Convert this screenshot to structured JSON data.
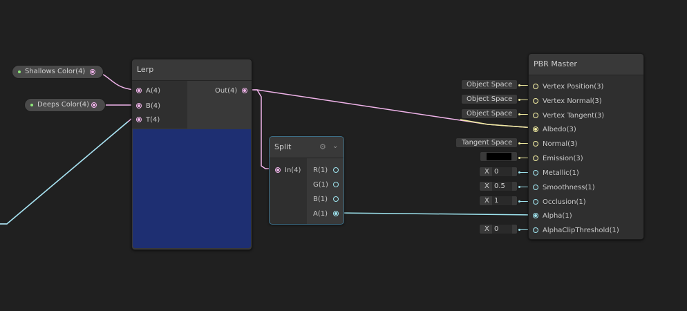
{
  "properties": {
    "shallows": {
      "label": "Shallows Color(4)"
    },
    "deeps": {
      "label": "Deeps Color(4)"
    }
  },
  "lerp": {
    "title": "Lerp",
    "inputs": [
      "A(4)",
      "B(4)",
      "T(4)"
    ],
    "output": "Out(4)",
    "preview_color": "#1e2f72"
  },
  "split": {
    "title": "Split",
    "input": "In(4)",
    "outputs": [
      "R(1)",
      "G(1)",
      "B(1)",
      "A(1)"
    ]
  },
  "master": {
    "title": "PBR Master",
    "ports": [
      "Vertex Position(3)",
      "Vertex Normal(3)",
      "Vertex Tangent(3)",
      "Albedo(3)",
      "Normal(3)",
      "Emission(3)",
      "Metallic(1)",
      "Smoothness(1)",
      "Occlusion(1)",
      "Alpha(1)",
      "AlphaClipThreshold(1)"
    ],
    "defaults": {
      "vertex_position": "Object Space",
      "vertex_normal": "Object Space",
      "vertex_tangent": "Object Space",
      "normal": "Tangent Space",
      "emission_color": "#000000",
      "metallic_axis": "X",
      "metallic": "0",
      "smoothness_axis": "X",
      "smoothness": "0.5",
      "occlusion_axis": "X",
      "occlusion": "1",
      "alphaclip_axis": "X",
      "alphaclip": "0"
    }
  },
  "colors": {
    "vector4_wire": "#f0b4ea",
    "vector3_wire": "#f2eda0",
    "vector1_wire": "#9ee4ef",
    "background": "#202020"
  }
}
